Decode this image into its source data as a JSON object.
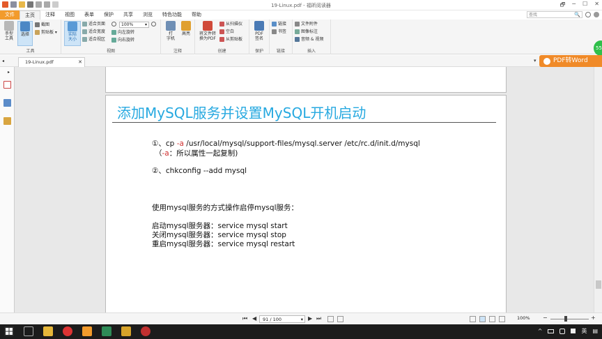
{
  "window": {
    "title": "19-Linux.pdf - 福昕阅读器",
    "controls": [
      "🗗",
      "─",
      "☐",
      "✕"
    ]
  },
  "quick_access": [
    "save-icon",
    "open-icon",
    "print-icon",
    "undo-icon",
    "redo-icon",
    "customize-icon"
  ],
  "menu": {
    "items": [
      "文件",
      "主页",
      "注释",
      "视图",
      "表单",
      "保护",
      "共享",
      "浏览",
      "特色功能",
      "帮助"
    ],
    "search_placeholder": "查找",
    "search_icon": "🔍"
  },
  "ribbon": {
    "tools": {
      "hand": "手型\n工具",
      "select": "选择",
      "snapshot": "截图",
      "clipboard": "剪贴板",
      "label": "工具"
    },
    "view": {
      "actual": "实际\n大小",
      "fit_page": "适合页面",
      "fit_width": "适合宽度",
      "fit_visible": "适合视区",
      "zoom": "100%",
      "rotate_left": "向左旋转",
      "rotate_right": "向右旋转",
      "label": "视图"
    },
    "comment": {
      "typewriter": "打\n字机",
      "highlight": "高亮",
      "label": "注释"
    },
    "create": {
      "convert": "将文件转\n换为PDF",
      "from_scanner": "从扫描仪",
      "blank": "空白",
      "from_clipboard": "从剪贴板",
      "label": "创建"
    },
    "protect": {
      "sign": "PDF\n签名",
      "label": "保护"
    },
    "links": {
      "link": "链接",
      "bookmark": "书签",
      "label": "链接"
    },
    "insert": {
      "attach": "文件附件",
      "image": "图像标注",
      "audio": "音频 & 视频",
      "label": "插入"
    }
  },
  "tab": {
    "name": "19-Linux.pdf",
    "close": "✕",
    "dropdown": "▾"
  },
  "banner": {
    "label": "PDF转Word"
  },
  "bubble": {
    "label": "55"
  },
  "page": {
    "title": "添加MySQL服务并设置MySQL开机启动",
    "lines": [
      {
        "parts": [
          "①、cp ",
          "-a",
          " /usr/local/mysql/support-files/mysql.server   /etc/rc.d/init.d/mysql"
        ]
      },
      {
        "parts": [
          "（",
          "-a",
          "：所以属性一起复制)"
        ]
      },
      {
        "parts": [
          "②、chkconfig --add mysql"
        ]
      },
      {
        "parts": [
          "使用mysql服务的方式操作启停mysql服务："
        ]
      },
      {
        "parts": [
          "启动mysql服务器：service mysql start"
        ]
      },
      {
        "parts": [
          "关闭mysql服务器：service mysql stop"
        ]
      },
      {
        "parts": [
          "重启mysql服务器：service mysql restart"
        ]
      }
    ]
  },
  "status": {
    "first": "⏮",
    "prev": "◀",
    "page_indicator": "91 / 100",
    "next": "▶",
    "last": "⏭",
    "zoom": "100%",
    "zoom_minus": "−",
    "zoom_plus": "+",
    "zoom_level": 0.4
  },
  "taskbar": {
    "tray_arrow": "^",
    "ime": "英",
    "notify": "▤"
  },
  "colors": {
    "accent_orange": "#f08a28",
    "title_blue": "#27a9e0",
    "file_menu": "#f29b2c"
  }
}
